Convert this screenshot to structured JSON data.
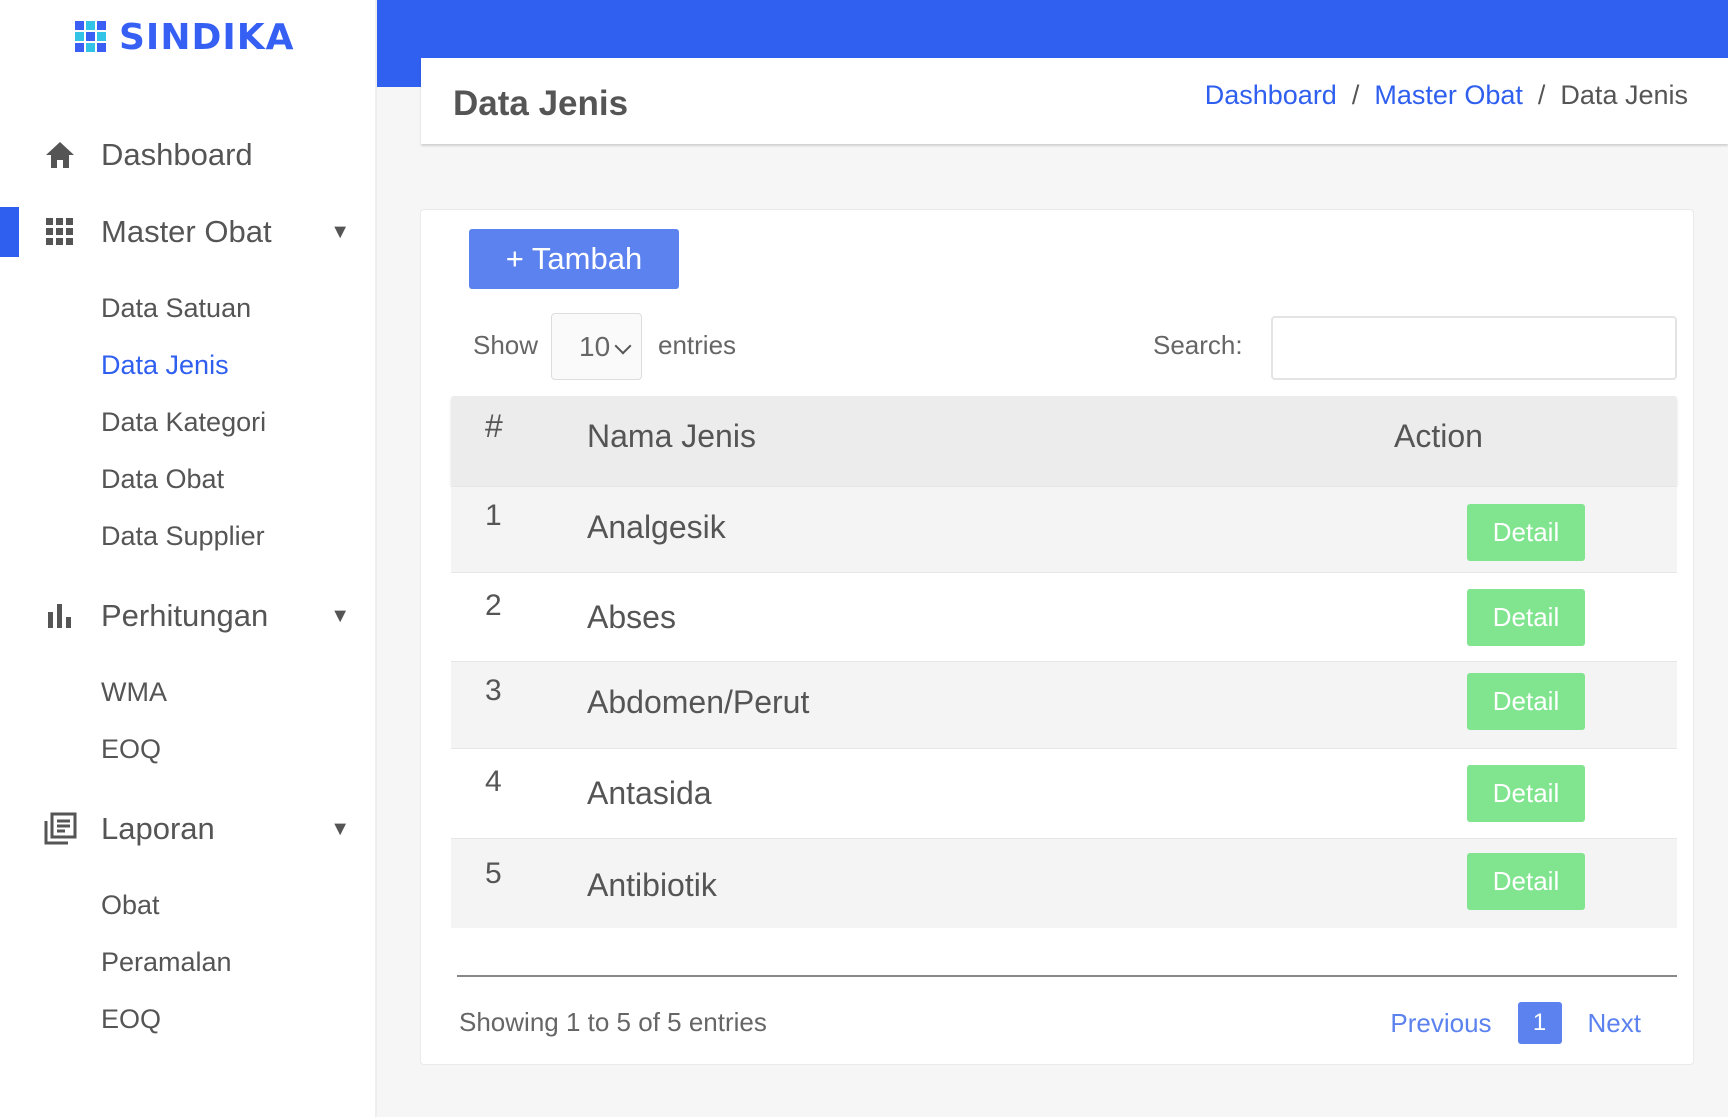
{
  "app": {
    "name": "SINDIKA"
  },
  "colors": {
    "primary": "#3060f0",
    "accent": "#5b82ee",
    "detail": "#81e48f"
  },
  "sidebar": {
    "items": [
      {
        "label": "Dashboard",
        "icon": "home-icon"
      },
      {
        "label": "Master Obat",
        "icon": "grid-icon",
        "active": true,
        "children": [
          "Data Satuan",
          "Data Jenis",
          "Data Kategori",
          "Data Obat",
          "Data Supplier"
        ]
      },
      {
        "label": "Perhitungan",
        "icon": "bar-chart-icon",
        "children": [
          "WMA",
          "EOQ"
        ]
      },
      {
        "label": "Laporan",
        "icon": "report-icon",
        "children": [
          "Obat",
          "Peramalan",
          "EOQ"
        ]
      }
    ],
    "active_child": "Data Jenis",
    "caret": "▼"
  },
  "header": {
    "title": "Data Jenis",
    "breadcrumb": {
      "home": "Dashboard",
      "parent": "Master Obat",
      "current": "Data Jenis",
      "sep": "/"
    }
  },
  "toolbar": {
    "add_label": "+ Tambah"
  },
  "controls": {
    "show_label": "Show",
    "page_size": "10",
    "entries_label": "entries",
    "search_label": "Search:",
    "search_value": ""
  },
  "table": {
    "columns": [
      "#",
      "Nama Jenis",
      "Action"
    ],
    "rows": [
      {
        "num": "1",
        "name": "Analgesik",
        "action": "Detail"
      },
      {
        "num": "2",
        "name": "Abses",
        "action": "Detail"
      },
      {
        "num": "3",
        "name": "Abdomen/Perut",
        "action": "Detail"
      },
      {
        "num": "4",
        "name": "Antasida",
        "action": "Detail"
      },
      {
        "num": "5",
        "name": "Antibiotik",
        "action": "Detail"
      }
    ]
  },
  "footer": {
    "info": "Showing 1 to 5 of 5 entries",
    "previous": "Previous",
    "current_page": "1",
    "next": "Next"
  }
}
